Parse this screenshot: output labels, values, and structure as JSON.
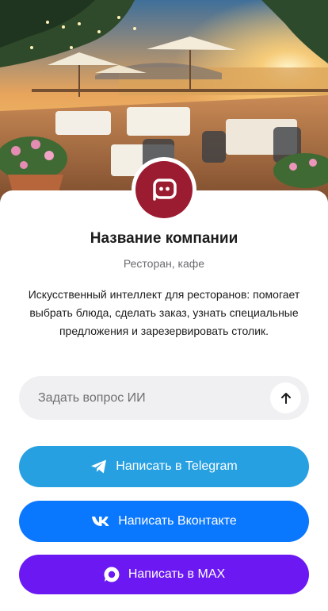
{
  "hero": {
    "image_description_icon": "restaurant-terrace-photo-icon"
  },
  "company": {
    "avatar_icon": "chat-bubble-icon",
    "name": "Название компании",
    "category": "Ресторан, кафе",
    "description": "Искусственный интеллект для ресторанов: помогает выбрать блюда, сделать заказ, узнать специальные предложения и зарезервировать столик."
  },
  "ask": {
    "placeholder": "Задать вопрос ИИ",
    "value": "",
    "send_icon": "arrow-up-icon"
  },
  "buttons": {
    "telegram": {
      "label": "Написать в Telegram",
      "icon": "telegram-icon"
    },
    "vk": {
      "label": "Написать Вконтакте",
      "icon": "vk-icon"
    },
    "max": {
      "label": "Написать в MAX",
      "icon": "max-icon"
    }
  },
  "colors": {
    "brand_avatar": "#9b1b30",
    "telegram": "#27a0e2",
    "vk": "#0a77ff",
    "max": "#6b18f2",
    "input_bg": "#f0f0f2"
  }
}
